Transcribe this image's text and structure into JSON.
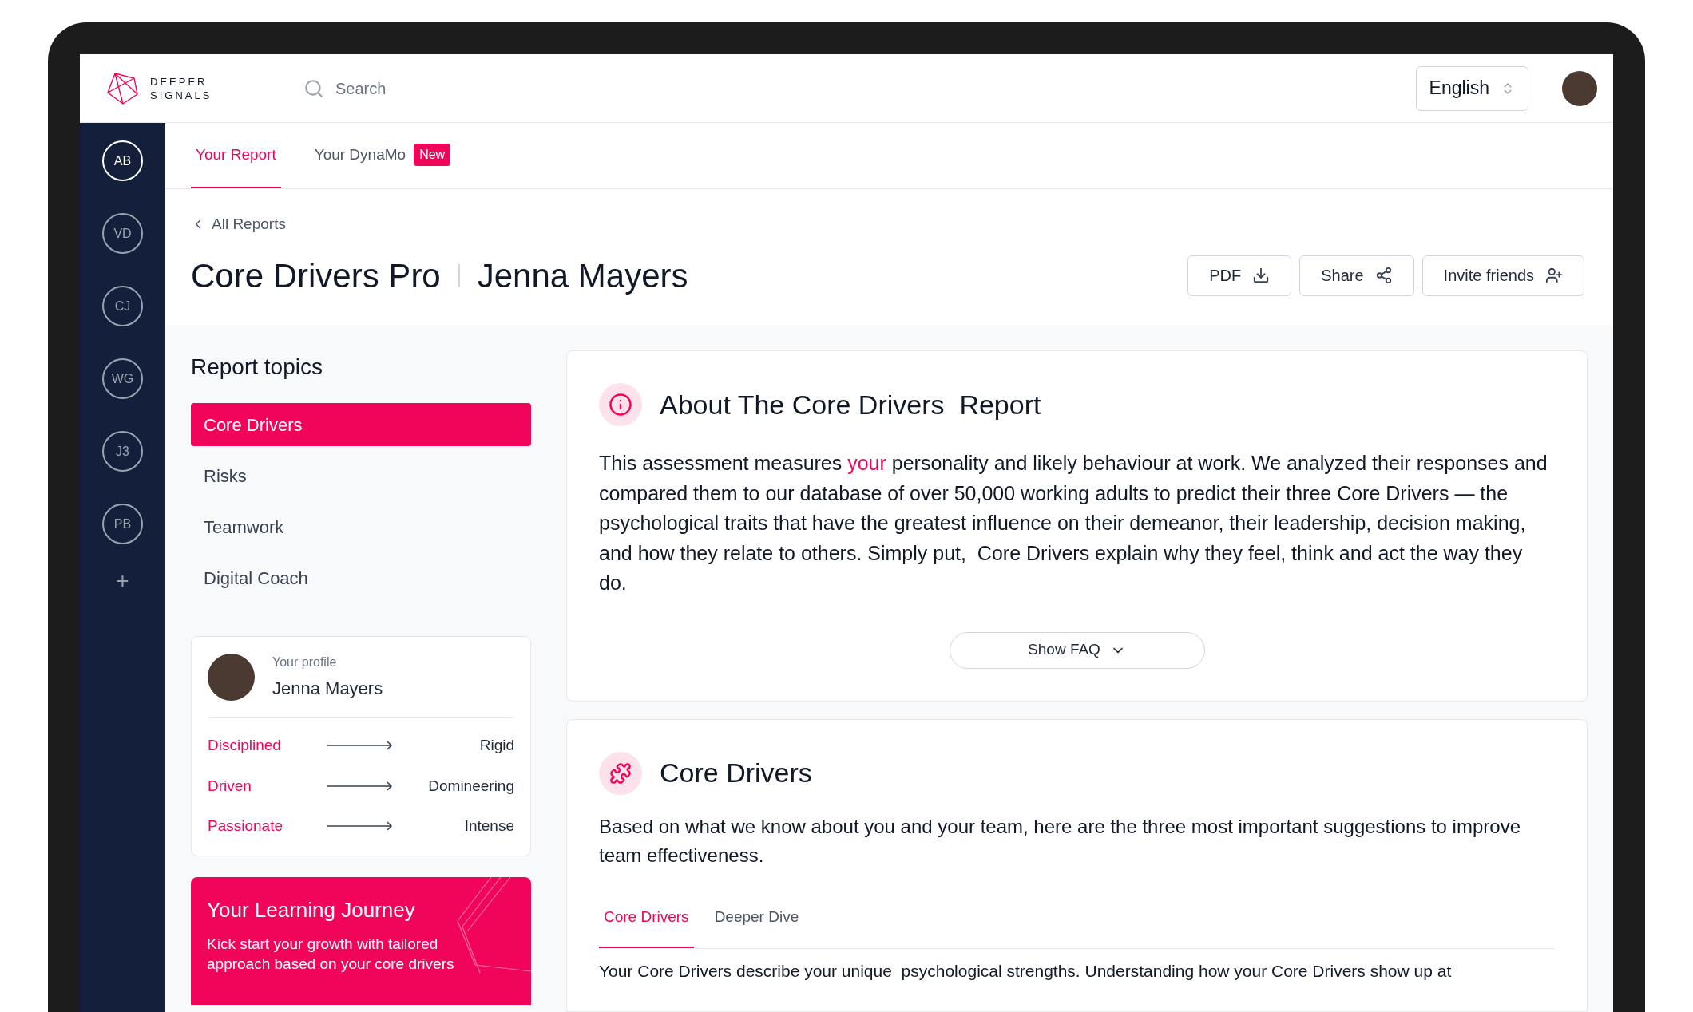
{
  "brand": {
    "line1": "DEEPER",
    "line2": "SIGNALS"
  },
  "search": {
    "placeholder": "Search"
  },
  "language": {
    "value": "English"
  },
  "sidebar": {
    "items": [
      {
        "label": "AB",
        "selected": true
      },
      {
        "label": "VD",
        "selected": false
      },
      {
        "label": "CJ",
        "selected": false
      },
      {
        "label": "WG",
        "selected": false
      },
      {
        "label": "J3",
        "selected": false
      },
      {
        "label": "PB",
        "selected": false
      }
    ],
    "add": "+"
  },
  "tabs": [
    {
      "label": "Your Report",
      "selected": true
    },
    {
      "label": "Your DynaMo",
      "selected": false,
      "badge": "New"
    }
  ],
  "breadcrumb": "All Reports",
  "title": {
    "report": "Core Drivers Pro",
    "person": "Jenna Mayers"
  },
  "actions": [
    {
      "label": "PDF",
      "kind": "download"
    },
    {
      "label": "Share",
      "kind": "share"
    },
    {
      "label": "Invite friends",
      "kind": "invite"
    }
  ],
  "topics": {
    "heading": "Report topics",
    "items": [
      {
        "label": "Core Drivers",
        "selected": true
      },
      {
        "label": "Risks",
        "selected": false
      },
      {
        "label": "Teamwork",
        "selected": false
      },
      {
        "label": "Digital Coach",
        "selected": false
      }
    ]
  },
  "profile": {
    "caption": "Your profile",
    "name": "Jenna Mayers",
    "rows": [
      {
        "from": "Disciplined",
        "to": "Rigid"
      },
      {
        "from": "Driven",
        "to": "Domineering"
      },
      {
        "from": "Passionate",
        "to": "Intense"
      }
    ]
  },
  "journey": {
    "title": "Your Learning Journey",
    "text": "Kick start your growth with tailored approach based on your core drivers"
  },
  "about": {
    "heading": "About The Core Drivers  Report",
    "body": "This assessment measures **your** personality and likely behaviour at work. We analyzed their responses and compared them to our database of over 50,000 working adults to predict their three Core Drivers — the psychological traits that have the greatest influence on their demeanor, their leadership, decision making, and how they relate to others. Simply put,  Core Drivers explain why they feel, think and act the way they do.",
    "faq": "Show FAQ"
  },
  "drivers": {
    "heading": "Core Drivers",
    "intro": "Based on what we know about you and your team, here are the three most important suggestions to improve team effectiveness.",
    "tabs": [
      {
        "label": "Core Drivers",
        "selected": true
      },
      {
        "label": "Deeper Dive",
        "selected": false
      }
    ],
    "body": "Your Core Drivers describe your unique  psychological strengths. Understanding how your Core Drivers show up at"
  }
}
